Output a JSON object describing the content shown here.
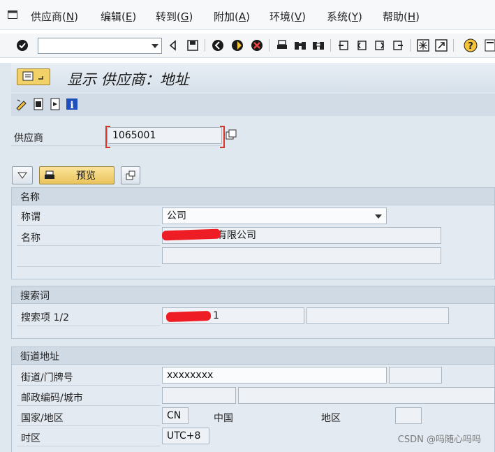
{
  "menu": [
    {
      "label": "供应商(",
      "key": "N",
      "suffix": ")"
    },
    {
      "label": "编辑(",
      "key": "E",
      "suffix": ")"
    },
    {
      "label": "转到(",
      "key": "G",
      "suffix": ")"
    },
    {
      "label": "附加(",
      "key": "A",
      "suffix": ")"
    },
    {
      "label": "环境(",
      "key": "V",
      "suffix": ")"
    },
    {
      "label": "系统(",
      "key": "Y",
      "suffix": ")"
    },
    {
      "label": "帮助(",
      "key": "H",
      "suffix": ")"
    }
  ],
  "command_field": {
    "value": ""
  },
  "page_title": "显示 供应商：地址",
  "vendor": {
    "label": "供应商",
    "value": "1065001"
  },
  "buttons": {
    "preview": "预览"
  },
  "group_name": {
    "title": "名称",
    "salutation_label": "称谓",
    "salutation_value": "公司",
    "name_label": "名称",
    "name_value": "有限公司",
    "name2_value": ""
  },
  "group_search": {
    "title": "搜索词",
    "term_label": "搜索项 1/2",
    "term1_value": "1",
    "term2_value": ""
  },
  "group_street": {
    "title": "街道地址",
    "street_label": "街道/门牌号",
    "street_value": "xxxxxxxx",
    "house_value": "",
    "postal_label": "邮政编码/城市",
    "postal_value": "",
    "city_value": "",
    "country_label": "国家/地区",
    "country_value": "CN",
    "country_name": "中国",
    "region_label": "地区",
    "region_value": "",
    "timezone_label": "时区",
    "timezone_value": "UTC+8"
  },
  "watermark": "CSDN @吗随心吗吗",
  "colors": {
    "accent": "#f3d169",
    "required": "#d9332a",
    "background": "#dfe7ef"
  }
}
